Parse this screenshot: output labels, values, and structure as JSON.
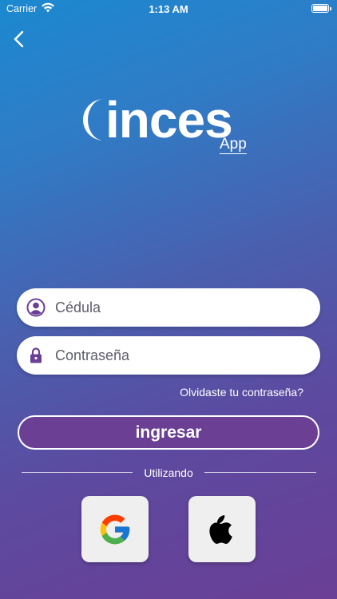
{
  "status_bar": {
    "carrier": "Carrier",
    "time": "1:13 AM"
  },
  "logo": {
    "brand": "inces",
    "sub": "App"
  },
  "form": {
    "cedula_placeholder": "Cédula",
    "password_placeholder": "Contraseña",
    "forgot_password": "Olvidaste tu contraseña?",
    "submit_label": "ingresar"
  },
  "social": {
    "divider_label": "Utilizando",
    "providers": [
      {
        "name": "google",
        "icon": "google-icon"
      },
      {
        "name": "apple",
        "icon": "apple-icon"
      }
    ]
  },
  "colors": {
    "gradient_top": "#1b89d0",
    "gradient_bottom": "#6a3f95",
    "accent_purple": "#6b3f93",
    "icon_purple": "#6a3f95"
  }
}
